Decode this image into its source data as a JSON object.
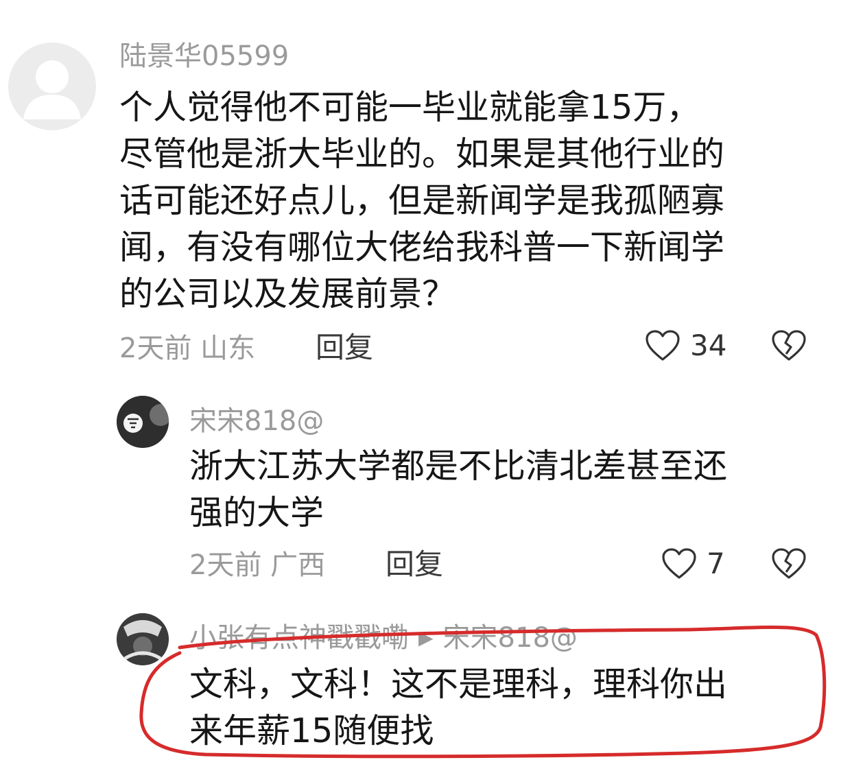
{
  "comments": [
    {
      "username": "陆景华05599",
      "text_lines": [
        "个人觉得他不可能一毕业就能拿15万，",
        "尽管他是浙大毕业的。如果是其他行业的",
        "话可能还好点儿，但是新闻学是我孤陋寡",
        "闻，有没有哪位大佬给我科普一下新闻学",
        "的公司以及发展前景？"
      ],
      "time_location": "2天前 山东",
      "reply_label": "回复",
      "likes": "34"
    },
    {
      "username": "宋宋818@",
      "text_lines": [
        "浙大江苏大学都是不比清北差甚至还",
        "强的大学"
      ],
      "time_location": "2天前 广西",
      "reply_label": "回复",
      "likes": "7"
    },
    {
      "username": "小张有点神戳戳嘞",
      "reply_to": "宋宋818@",
      "text_lines": [
        "文科，文科！这不是理科，理科你出",
        "来年薪15随便找"
      ]
    }
  ],
  "icons": {
    "like": "heart-outline-icon",
    "dislike": "broken-heart-icon",
    "reply_arrow": "play-arrow-icon"
  },
  "colors": {
    "highlight_stroke": "#d62b2b",
    "meta_text": "#9a9a9a",
    "body_text": "#161616"
  }
}
